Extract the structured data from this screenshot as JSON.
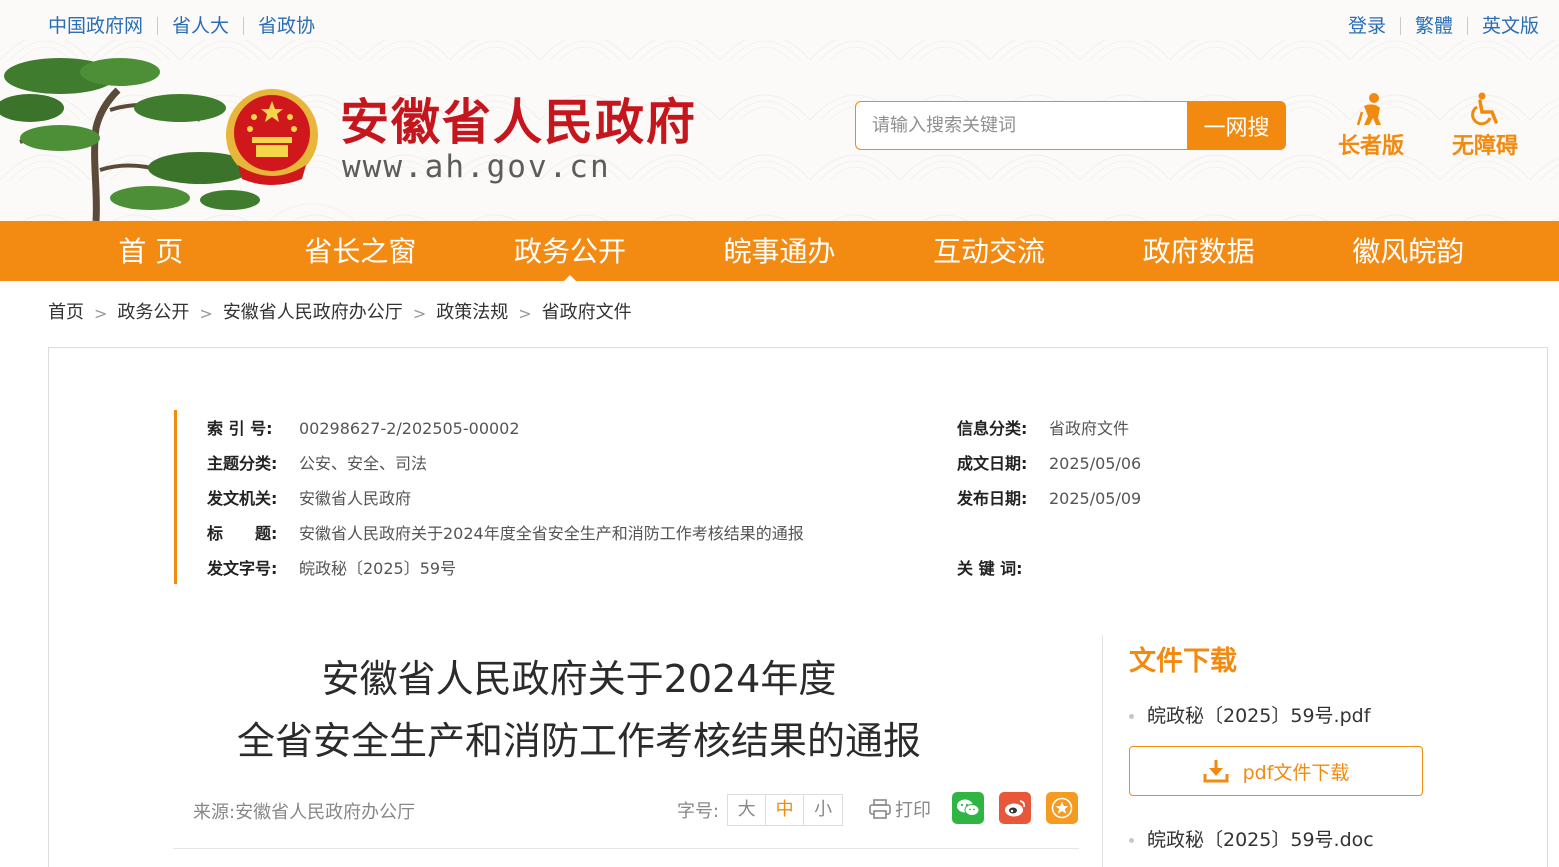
{
  "top_links": {
    "left": [
      "中国政府网",
      "省人大",
      "省政协"
    ],
    "right": [
      "登录",
      "繁體",
      "英文版"
    ]
  },
  "site": {
    "name": "安徽省人民政府",
    "url": "www.ah.gov.cn"
  },
  "search": {
    "placeholder": "请输入搜索关键词",
    "button": "一网搜"
  },
  "tools": {
    "elder": "长者版",
    "accessible": "无障碍"
  },
  "nav": [
    "首 页",
    "省长之窗",
    "政务公开",
    "皖事通办",
    "互动交流",
    "政府数据",
    "徽风皖韵"
  ],
  "nav_active_index": 2,
  "breadcrumb": [
    "首页",
    "政务公开",
    "安徽省人民政府办公厅",
    "政策法规",
    "省政府文件"
  ],
  "meta": {
    "index_no": {
      "label": "索 引 号:",
      "value": "00298627-2/202505-00002"
    },
    "topic": {
      "label": "主题分类:",
      "value": "公安、安全、司法"
    },
    "issuer": {
      "label": "发文机关:",
      "value": "安徽省人民政府"
    },
    "title": {
      "label": "标　　题:",
      "value": "安徽省人民政府关于2024年度全省安全生产和消防工作考核结果的通报"
    },
    "doc_no": {
      "label": "发文字号:",
      "value": "皖政秘〔2025〕59号"
    },
    "info_class": {
      "label": "信息分类:",
      "value": "省政府文件"
    },
    "written_date": {
      "label": "成文日期:",
      "value": "2025/05/06"
    },
    "publish_date": {
      "label": "发布日期:",
      "value": "2025/05/09"
    },
    "keywords": {
      "label": "关 键 词:",
      "value": ""
    }
  },
  "document": {
    "title_line1": "安徽省人民政府关于2024年度",
    "title_line2": "全省安全生产和消防工作考核结果的通报",
    "source_label": "来源:",
    "source": "安徽省人民政府办公厅",
    "fontsize_label": "字号:",
    "fontsize_options": [
      "大",
      "中",
      "小"
    ],
    "fontsize_selected": "中",
    "print": "打印"
  },
  "download": {
    "heading": "文件下载",
    "files": [
      "皖政秘〔2025〕59号.pdf",
      "皖政秘〔2025〕59号.doc"
    ],
    "pdf_button": "pdf文件下载"
  },
  "colors": {
    "orange": "#f38b12",
    "red": "#c5161d",
    "link_blue": "#2b6eb5"
  }
}
